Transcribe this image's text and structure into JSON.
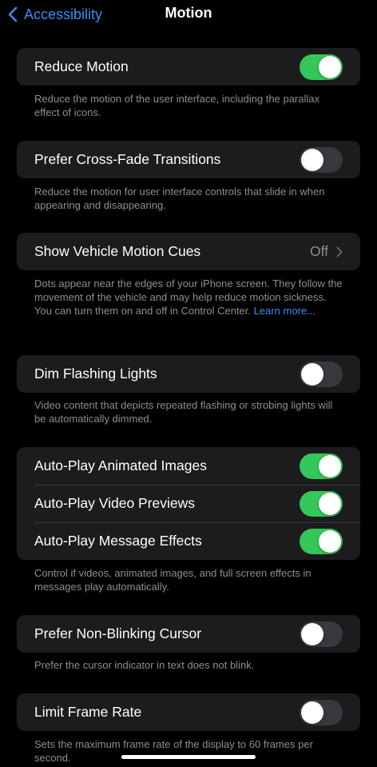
{
  "nav": {
    "back_label": "Accessibility",
    "title": "Motion"
  },
  "sections": {
    "reduce_motion": {
      "label": "Reduce Motion",
      "on": true,
      "footer": "Reduce the motion of the user interface, including the parallax effect of icons."
    },
    "cross_fade": {
      "label": "Prefer Cross-Fade Transitions",
      "on": false,
      "footer": "Reduce the motion for user interface controls that slide in when appearing and disappearing."
    },
    "vehicle_cues": {
      "label": "Show Vehicle Motion Cues",
      "value": "Off",
      "footer": "Dots appear near the edges of your iPhone screen. They follow the movement of the vehicle and may help reduce motion sickness. You can turn them on and off in Control Center.",
      "link": "Learn more..."
    },
    "dim_flashing": {
      "label": "Dim Flashing Lights",
      "on": false,
      "footer": "Video content that depicts repeated flashing or strobing lights will be automatically dimmed."
    },
    "autoplay": {
      "animated_images": {
        "label": "Auto-Play Animated Images",
        "on": true
      },
      "video_previews": {
        "label": "Auto-Play Video Previews",
        "on": true
      },
      "message_effects": {
        "label": "Auto-Play Message Effects",
        "on": true
      },
      "footer": "Control if videos, animated images, and full screen effects in messages play automatically."
    },
    "non_blinking": {
      "label": "Prefer Non-Blinking Cursor",
      "on": false,
      "footer": "Prefer the cursor indicator in text does not blink."
    },
    "frame_rate": {
      "label": "Limit Frame Rate",
      "on": false,
      "footer": "Sets the maximum frame rate of the display to 60 frames per second."
    }
  },
  "colors": {
    "background": "#000000",
    "cell": "#1c1c1e",
    "accent": "#3a8cf7",
    "toggle_on": "#34c759",
    "toggle_off": "#39393d",
    "secondary_text": "#8e8e93"
  },
  "icons": {
    "back": "chevron-left-icon",
    "disclosure": "chevron-right-icon"
  }
}
